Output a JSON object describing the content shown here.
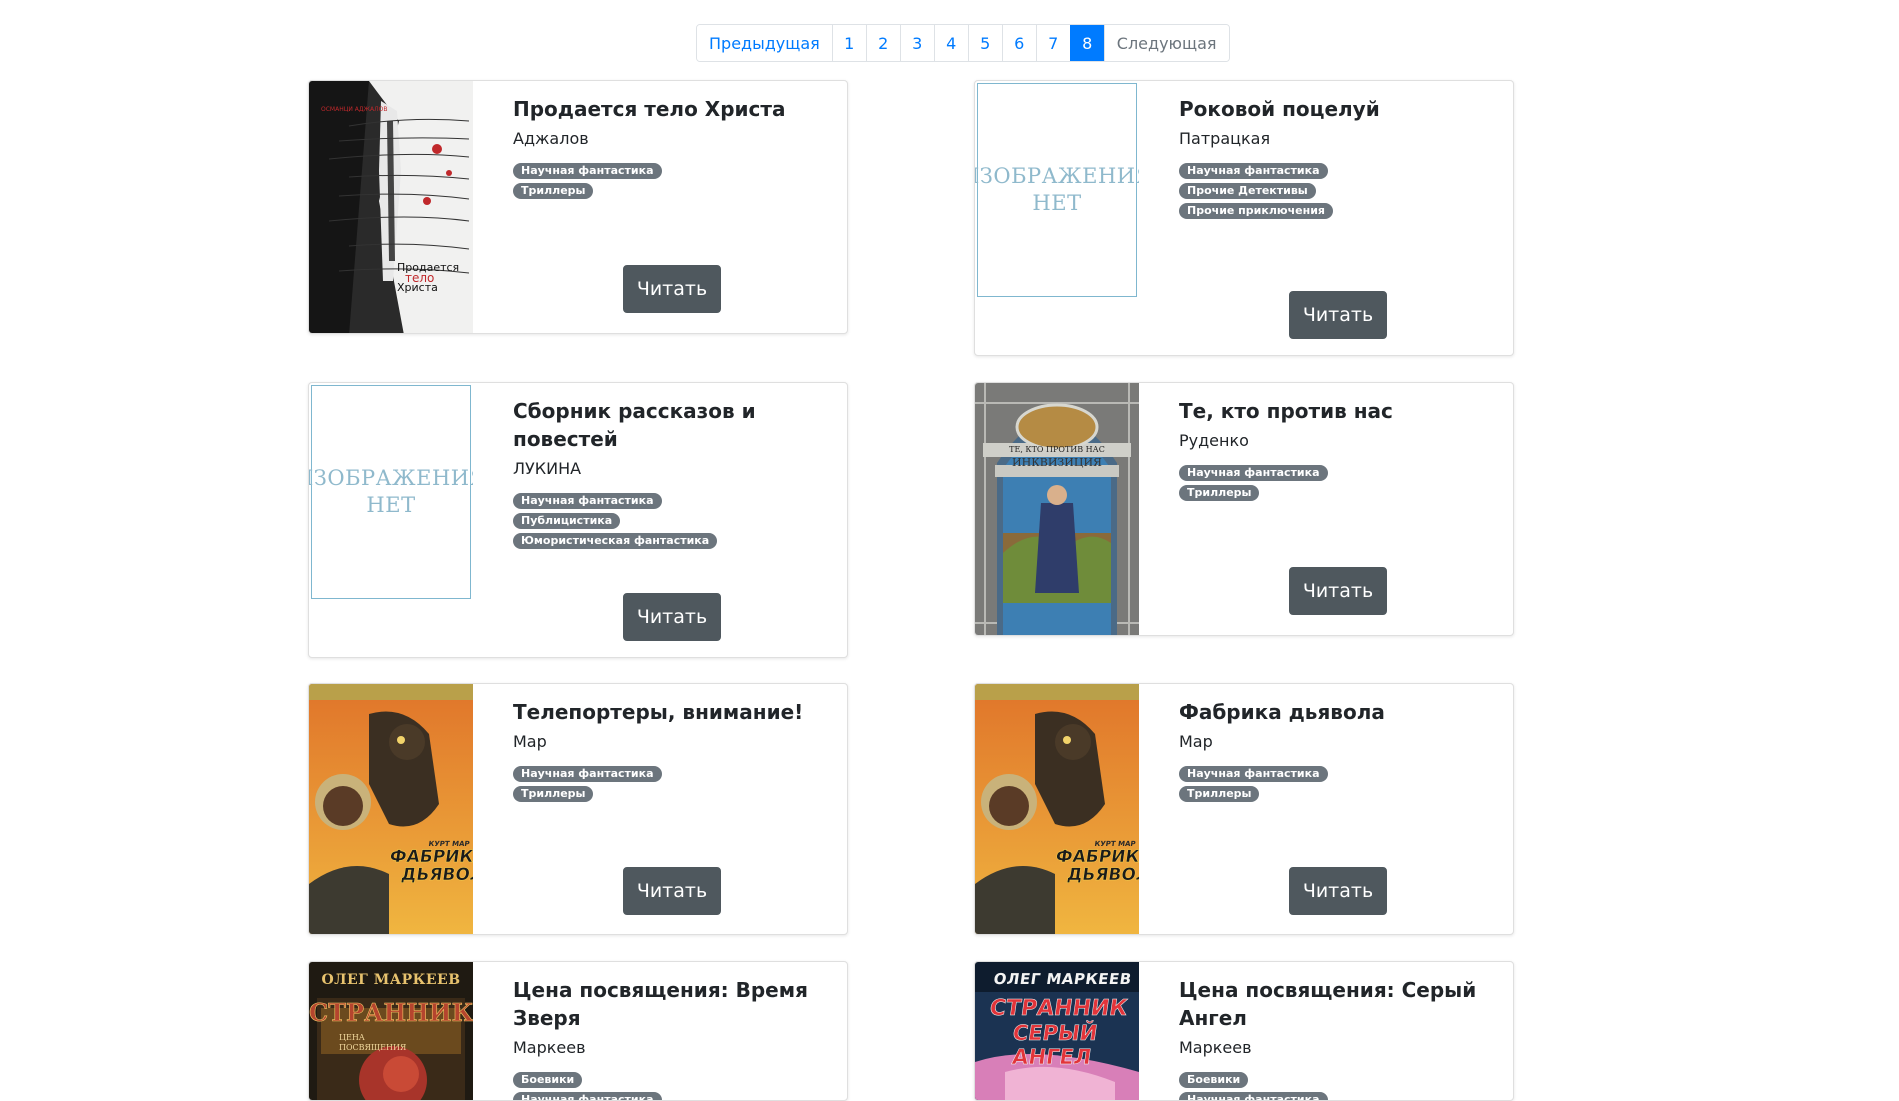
{
  "pagination": {
    "prev": "Предыдущая",
    "pages": [
      "1",
      "2",
      "3",
      "4",
      "5",
      "6",
      "7",
      "8"
    ],
    "active": "8",
    "next": "Следующая"
  },
  "read_label": "Читать",
  "no_image_text": [
    "ИЗОБРАЖЕНИЯ",
    "НЕТ"
  ],
  "books": [
    {
      "title": "Продается тело Христа",
      "author": "Аджалов",
      "genres": [
        "Научная фантастика",
        "Триллеры"
      ],
      "cover": "cover-body-of-christ",
      "cover_text": [
        "Продается",
        "тело",
        "Христа"
      ]
    },
    {
      "title": "Роковой поцелуй",
      "author": "Патрацкая",
      "genres": [
        "Научная фантастика",
        "Прочие Детективы",
        "Прочие приключения"
      ],
      "cover": "no-image"
    },
    {
      "title": "Сборник рассказов и повестей",
      "author": "ЛУКИНА",
      "genres": [
        "Научная фантастика",
        "Публицистика",
        "Юмористическая фантастика"
      ],
      "cover": "no-image"
    },
    {
      "title": "Те, кто против нас",
      "author": "Руденко",
      "genres": [
        "Научная фантастика",
        "Триллеры"
      ],
      "cover": "cover-inquisition",
      "cover_text": [
        "ТЕ, КТО ПРОТИВ НАС",
        "ИНКВИЗИЦИЯ"
      ]
    },
    {
      "title": "Телепортеры, внимание!",
      "author": "Мар",
      "genres": [
        "Научная фантастика",
        "Триллеры"
      ],
      "cover": "cover-devil-factory",
      "cover_text": [
        "КУРТ МАР",
        "ФАБРИКА",
        "ДЬЯВОЛА"
      ]
    },
    {
      "title": "Фабрика дьявола",
      "author": "Мар",
      "genres": [
        "Научная фантастика",
        "Триллеры"
      ],
      "cover": "cover-devil-factory",
      "cover_text": [
        "КУРТ МАР",
        "ФАБРИКА",
        "ДЬЯВОЛА"
      ]
    },
    {
      "title": "Цена посвящения: Время Зверя",
      "author": "Маркеев",
      "genres": [
        "Боевики",
        "Научная фантастика"
      ],
      "cover": "cover-wanderer-beast",
      "cover_text": [
        "ОЛЕГ МАРКЕЕВ",
        "СТРАННИК",
        "ЦЕНА ПОСВЯЩЕНИЯ"
      ]
    },
    {
      "title": "Цена посвящения: Серый Ангел",
      "author": "Маркеев",
      "genres": [
        "Боевики",
        "Научная фантастика"
      ],
      "cover": "cover-wanderer-angel",
      "cover_text": [
        "ОЛЕГ МАРКЕЕВ",
        "СТРАННИК",
        "СЕРЫЙ АНГЕЛ"
      ]
    }
  ]
}
